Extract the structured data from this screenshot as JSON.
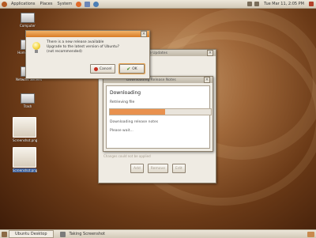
{
  "panel": {
    "menus": [
      "Applications",
      "Places",
      "System"
    ],
    "clock": "Tue Mar 11, 2:05 PM"
  },
  "desktop": {
    "icons": [
      {
        "label": "Computer"
      },
      {
        "label": "Home Folder"
      },
      {
        "label": "Network Servers"
      },
      {
        "label": "Trash"
      },
      {
        "label": "Screenshot.png"
      },
      {
        "label": "Screenshot.png"
      }
    ]
  },
  "prompt_dialog": {
    "message_lines": [
      "There is a new release available",
      "Upgrade to the latest version of Ubuntu?",
      "(not recommended)"
    ],
    "cancel_label": "Cancel",
    "ok_label": "OK"
  },
  "bg_window": {
    "title": "Software Updates",
    "status_line": "Changes could not be applied",
    "disabled_buttons": [
      "Add",
      "Remove",
      "Edit"
    ]
  },
  "download_dialog": {
    "title": "Downloading Release Notes",
    "heading": "Downloading",
    "step_label": "Retrieving file",
    "progress": 0.55,
    "status_lines": [
      "Downloading release notes",
      "Please wait..."
    ]
  },
  "taskbar": {
    "items": [
      "Ubuntu Desktop",
      "Taking Screenshot"
    ]
  },
  "colors": {
    "accent": "#e59a4a",
    "progress_fill": "#e9914e"
  }
}
